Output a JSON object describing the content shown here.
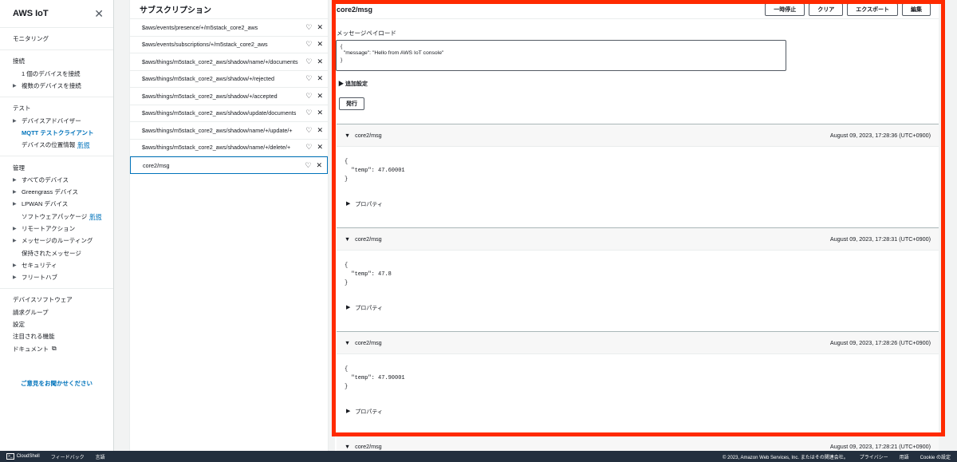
{
  "sidebar": {
    "title": "AWS IoT",
    "monitoring": "モニタリング",
    "connect": {
      "header": "接続",
      "items": [
        {
          "label": "1 個のデバイスを接続",
          "expandable": false
        },
        {
          "label": "複数のデバイスを接続",
          "expandable": true
        }
      ]
    },
    "test": {
      "header": "テスト",
      "items": [
        {
          "label": "デバイスアドバイザー",
          "expandable": true
        },
        {
          "label": "MQTT テストクライアント",
          "active": true
        },
        {
          "label": "デバイスの位置情報",
          "badge": "新規"
        }
      ]
    },
    "manage": {
      "header": "管理",
      "items": [
        {
          "label": "すべてのデバイス",
          "expandable": true
        },
        {
          "label": "Greengrass デバイス",
          "expandable": true
        },
        {
          "label": "LPWAN デバイス",
          "expandable": true
        },
        {
          "label": "ソフトウェアパッケージ",
          "badge": "新規"
        },
        {
          "label": "リモートアクション",
          "expandable": true
        },
        {
          "label": "メッセージのルーティング",
          "expandable": true
        },
        {
          "label": "保持されたメッセージ"
        },
        {
          "label": "セキュリティ",
          "expandable": true
        },
        {
          "label": "フリートハブ",
          "expandable": true
        }
      ]
    },
    "other": [
      "デバイスソフトウェア",
      "請求グループ",
      "設定",
      "注目される機能",
      "ドキュメント"
    ],
    "feedback": "ご意見をお聞かせください"
  },
  "subscriptions": {
    "header": "サブスクリプション",
    "items": [
      "$aws/events/presence/+/m5stack_core2_aws",
      "$aws/events/subscriptions/+/m5stack_core2_aws",
      "$aws/things/m5stack_core2_aws/shadow/name/+/documents",
      "$aws/things/m5stack_core2_aws/shadow/+/rejected",
      "$aws/things/m5stack_core2_aws/shadow/+/accepted",
      "$aws/things/m5stack_core2_aws/shadow/update/documents",
      "$aws/things/m5stack_core2_aws/shadow/name/+/update/+",
      "$aws/things/m5stack_core2_aws/shadow/name/+/delete/+",
      "core2/msg"
    ]
  },
  "main": {
    "topic": "core2/msg",
    "buttons": {
      "pause": "一時停止",
      "clear": "クリア",
      "export": "エクスポート",
      "edit": "編集"
    },
    "payload_label": "メッセージペイロード",
    "payload_value": "{\n  \"message\": \"Hello from AWS IoT console\"\n}",
    "additional_settings": "追加設定",
    "publish": "発行",
    "messages": [
      {
        "topic": "core2/msg",
        "timestamp": "August 09, 2023, 17:28:36 (UTC+0900)",
        "body": "{\n  \"temp\": 47.60001\n}",
        "props": "プロパティ"
      },
      {
        "topic": "core2/msg",
        "timestamp": "August 09, 2023, 17:28:31 (UTC+0900)",
        "body": "{\n  \"temp\": 47.8\n}",
        "props": "プロパティ"
      },
      {
        "topic": "core2/msg",
        "timestamp": "August 09, 2023, 17:28:26 (UTC+0900)",
        "body": "{\n  \"temp\": 47.90001\n}",
        "props": "プロパティ"
      },
      {
        "topic": "core2/msg",
        "timestamp": "August 09, 2023, 17:28:21 (UTC+0900)"
      }
    ]
  },
  "footer": {
    "cloudshell": "CloudShell",
    "feedback": "フィードバック",
    "language": "言語",
    "copyright": "© 2023, Amazon Web Services, Inc. またはその関連会社。",
    "privacy": "プライバシー",
    "terms": "用語",
    "cookie": "Cookie の設定"
  },
  "colors": {
    "highlight": "#ff2a00",
    "link": "#0073bb",
    "footer_bg": "#232f3e"
  }
}
